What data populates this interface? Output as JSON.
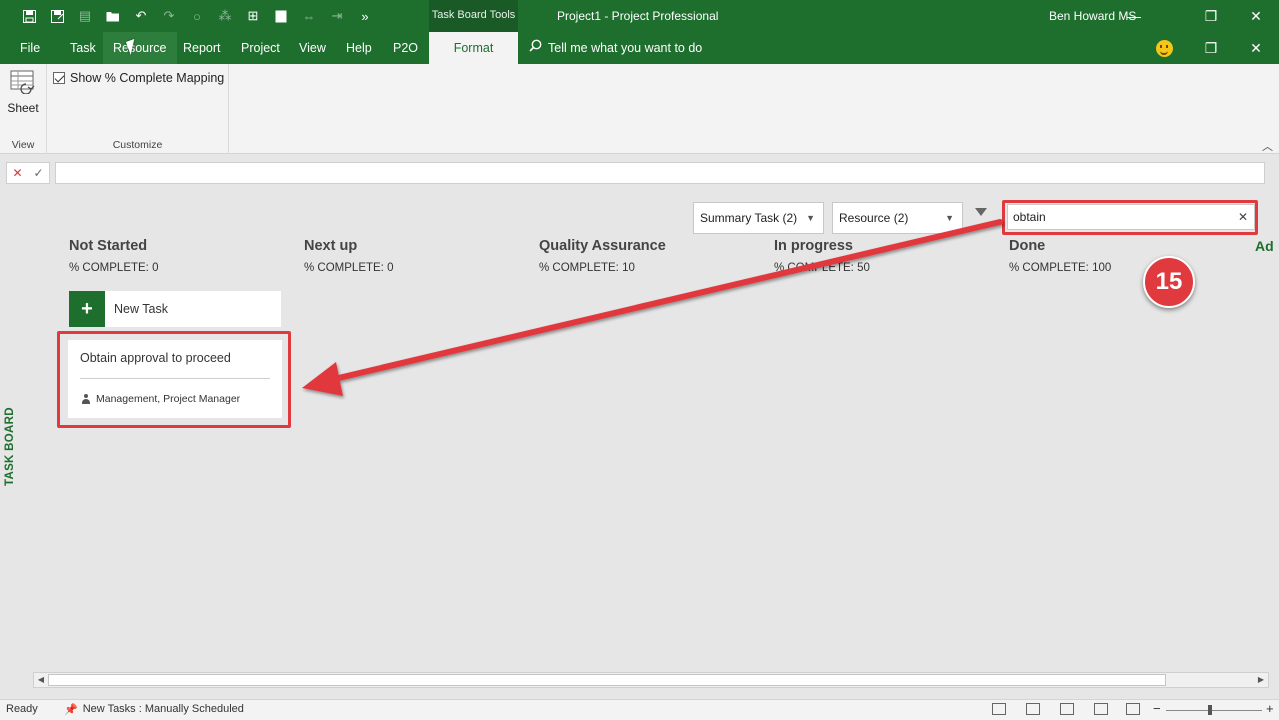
{
  "titlebar": {
    "contextual_tab": "Task Board Tools",
    "window_title": "Project1  -  Project Professional",
    "user_name": "Ben Howard MS"
  },
  "tabs": {
    "file": "File",
    "task": "Task",
    "resource": "Resource",
    "report": "Report",
    "project": "Project",
    "view": "View",
    "help": "Help",
    "p2o": "P2O",
    "format": "Format",
    "tell_me": "Tell me what you want to do"
  },
  "ribbon": {
    "sheet_label": "Sheet",
    "view_group": "View",
    "show_mapping_label": "Show % Complete Mapping",
    "show_mapping_checked": true,
    "customize_group": "Customize"
  },
  "board": {
    "side_label": "TASK BOARD",
    "summary_filter": "Summary Task (2)",
    "resource_filter": "Resource (2)",
    "search_value": "obtain",
    "add_column": "Ad",
    "columns": [
      {
        "title": "Not Started",
        "pct": "% COMPLETE: 0"
      },
      {
        "title": "Next up",
        "pct": "% COMPLETE: 0"
      },
      {
        "title": "Quality Assurance",
        "pct": "% COMPLETE: 10"
      },
      {
        "title": "In progress",
        "pct": "% COMPLETE: 50"
      },
      {
        "title": "Done",
        "pct": "% COMPLETE: 100"
      }
    ],
    "new_task_label": "New Task",
    "card": {
      "title": "Obtain approval to proceed",
      "resources": "Management, Project Manager"
    }
  },
  "annotation": {
    "step": "15",
    "color": "#e0393e"
  },
  "statusbar": {
    "ready": "Ready",
    "mode": "New Tasks : Manually Scheduled"
  },
  "colors": {
    "brand_green": "#1e6f2e",
    "ribbon_bg": "#f3f3f3",
    "canvas_bg": "#e6e6e6"
  }
}
